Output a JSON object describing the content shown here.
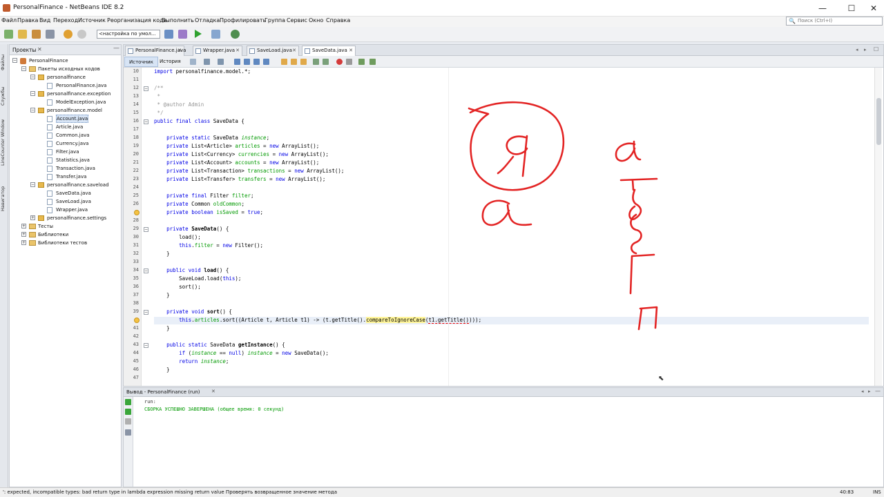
{
  "window": {
    "title": "PersonalFinance - NetBeans IDE 8.2",
    "minimize": "—",
    "maximize": "☐",
    "close": "✕"
  },
  "menu": [
    "Файл",
    "Правка",
    "Вид",
    "Переход",
    "Источник",
    "Реорганизация кода",
    "Выполнить",
    "Отладка",
    "Профилировать",
    "Группа",
    "Сервис",
    "Окно",
    "Справка"
  ],
  "toolbar": {
    "config_value": "<настройка по умол...",
    "search_placeholder": "Поиск (Ctrl+I)"
  },
  "side_labels": [
    "Файлы",
    "Службы",
    "LineCounter Window",
    "Навигатор"
  ],
  "projects": {
    "title": "Проекты",
    "tree": [
      {
        "label": "PersonalFinance",
        "level": 0,
        "icon": "project"
      },
      {
        "label": "Пакеты исходных кодов",
        "level": 1,
        "icon": "folder"
      },
      {
        "label": "personalfinance",
        "level": 2,
        "icon": "package"
      },
      {
        "label": "PersonalFinance.java",
        "level": 3,
        "icon": "java"
      },
      {
        "label": "personalfinance.exception",
        "level": 2,
        "icon": "package"
      },
      {
        "label": "ModelException.java",
        "level": 3,
        "icon": "java"
      },
      {
        "label": "personalfinance.model",
        "level": 2,
        "icon": "package"
      },
      {
        "label": "Account.java",
        "level": 3,
        "icon": "java",
        "selected": true
      },
      {
        "label": "Article.java",
        "level": 3,
        "icon": "java"
      },
      {
        "label": "Common.java",
        "level": 3,
        "icon": "java"
      },
      {
        "label": "Currency.java",
        "level": 3,
        "icon": "java"
      },
      {
        "label": "Filter.java",
        "level": 3,
        "icon": "java"
      },
      {
        "label": "Statistics.java",
        "level": 3,
        "icon": "java"
      },
      {
        "label": "Transaction.java",
        "level": 3,
        "icon": "java"
      },
      {
        "label": "Transfer.java",
        "level": 3,
        "icon": "java"
      },
      {
        "label": "personalfinance.saveload",
        "level": 2,
        "icon": "package"
      },
      {
        "label": "SaveData.java",
        "level": 3,
        "icon": "java"
      },
      {
        "label": "SaveLoad.java",
        "level": 3,
        "icon": "java"
      },
      {
        "label": "Wrapper.java",
        "level": 3,
        "icon": "java"
      },
      {
        "label": "personalfinance.settings",
        "level": 2,
        "icon": "package"
      },
      {
        "label": "Тесты",
        "level": 1,
        "icon": "folder"
      },
      {
        "label": "Библиотеки",
        "level": 1,
        "icon": "folder"
      },
      {
        "label": "Библиотеки тестов",
        "level": 1,
        "icon": "folder"
      }
    ]
  },
  "editor": {
    "tabs": [
      "PersonalFinance.java",
      "Wrapper.java",
      "SaveLoad.java",
      "SaveData.java"
    ],
    "active_tab": "SaveData.java",
    "mode_tabs": [
      "Источник",
      "История"
    ],
    "lines": [
      {
        "n": "10",
        "text": "import personalfinance.model.*;"
      },
      {
        "n": "11",
        "text": ""
      },
      {
        "n": "12",
        "text": "/**"
      },
      {
        "n": "13",
        "text": " *"
      },
      {
        "n": "14",
        "text": " * @author Admin"
      },
      {
        "n": "15",
        "text": " */"
      },
      {
        "n": "16",
        "text": "public final class SaveData {"
      },
      {
        "n": "17",
        "text": ""
      },
      {
        "n": "18",
        "text": "    private static SaveData instance;"
      },
      {
        "n": "19",
        "text": "    private List<Article> articles = new ArrayList();"
      },
      {
        "n": "20",
        "text": "    private List<Currency> currencies = new ArrayList();"
      },
      {
        "n": "21",
        "text": "    private List<Account> accounts = new ArrayList();"
      },
      {
        "n": "22",
        "text": "    private List<Transaction> transactions = new ArrayList();"
      },
      {
        "n": "23",
        "text": "    private List<Transfer> transfers = new ArrayList();"
      },
      {
        "n": "24",
        "text": ""
      },
      {
        "n": "25",
        "text": "    private final Filter filter;"
      },
      {
        "n": "26",
        "text": "    private Common oldCommon;"
      },
      {
        "n": "",
        "text": "    private boolean isSaved = true;"
      },
      {
        "n": "28",
        "text": ""
      },
      {
        "n": "29",
        "text": "    private SaveData() {"
      },
      {
        "n": "30",
        "text": "        load();"
      },
      {
        "n": "31",
        "text": "        this.filter = new Filter();"
      },
      {
        "n": "32",
        "text": "    }"
      },
      {
        "n": "33",
        "text": ""
      },
      {
        "n": "34",
        "text": "    public void load() {"
      },
      {
        "n": "35",
        "text": "        SaveLoad.load(this);"
      },
      {
        "n": "36",
        "text": "        sort();"
      },
      {
        "n": "37",
        "text": "    }"
      },
      {
        "n": "38",
        "text": ""
      },
      {
        "n": "39",
        "text": "    private void sort() {"
      },
      {
        "n": "",
        "text": "        this.articles.sort((Article t, Article t1) -> (t.getTitle().compareToIgnoreCase(t1.getTitle())));"
      },
      {
        "n": "41",
        "text": "    }"
      },
      {
        "n": "42",
        "text": ""
      },
      {
        "n": "43",
        "text": "    public static SaveData getInstance() {"
      },
      {
        "n": "44",
        "text": "        if (instance == null) instance = new SaveData();"
      },
      {
        "n": "45",
        "text": "        return instance;"
      },
      {
        "n": "46",
        "text": "    }"
      },
      {
        "n": "47",
        "text": ""
      }
    ]
  },
  "handwriting": [
    "я",
    "а",
    "а",
    "б",
    "в",
    "г",
    "п"
  ],
  "output": {
    "title": "Вывод - PersonalFinance (run)",
    "lines": [
      "run:",
      "СБОРКА УСПЕШНО ЗАВЕРШЕНА (общее время: 0 секунд)"
    ]
  },
  "status": {
    "message": "': expected, incompatible types: bad return type in lambda expression    missing return value  Проверять возвращенное значение метода",
    "position": "40:83",
    "mode": "INS"
  },
  "colors": {
    "keyword": "#0000e6",
    "field": "#009900",
    "comment": "#969696",
    "highlight": "#fff59a",
    "ink": "#e32424"
  }
}
